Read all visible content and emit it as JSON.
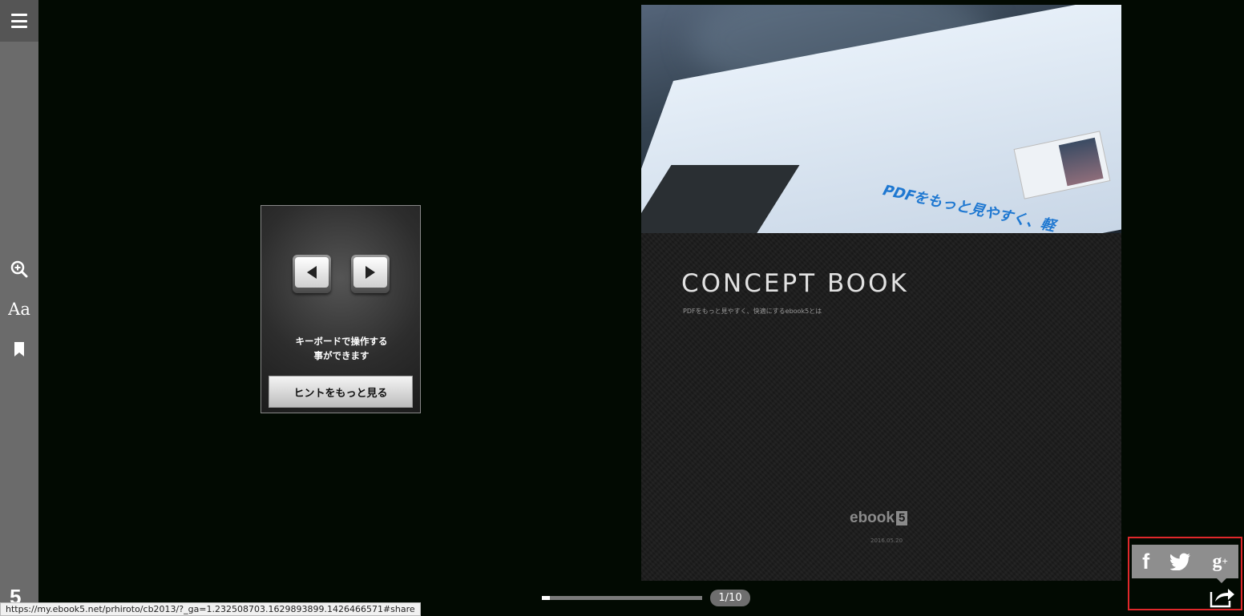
{
  "sidebar": {
    "menu_icon": "hamburger-icon",
    "zoom_icon": "zoom-in-icon",
    "font_label": "Aa",
    "bookmark_icon": "bookmark-icon",
    "logo_text": "5"
  },
  "hint": {
    "left_key_icon": "arrow-left-icon",
    "right_key_icon": "arrow-right-icon",
    "text_line1": "キーボードで操作する",
    "text_line2": "事ができます",
    "button_label": "ヒントをもっと見る"
  },
  "page": {
    "photo_text": "PDFをもっと見やすく、軽",
    "title": "CONCEPT BOOK",
    "subtitle": "PDFをもっと見やすく、快適にするebook5とは",
    "logo_text": "ebook",
    "logo_num": "5",
    "date": "2016.05.20"
  },
  "navigation": {
    "progress": 0.05,
    "page_indicator": "1/10"
  },
  "share": {
    "facebook_label": "f",
    "google_label": "g",
    "google_sup": "+",
    "share_icon": "share-arrow-icon"
  },
  "status": {
    "url": "https://my.ebook5.net/prhiroto/cb2013/?_ga=1.232508703.1629893899.1426466571#share"
  },
  "colors": {
    "background": "#020a02",
    "sidebar": "#6b6b6b",
    "highlight": "#e0282b",
    "share_bar": "#8e8e8e"
  }
}
